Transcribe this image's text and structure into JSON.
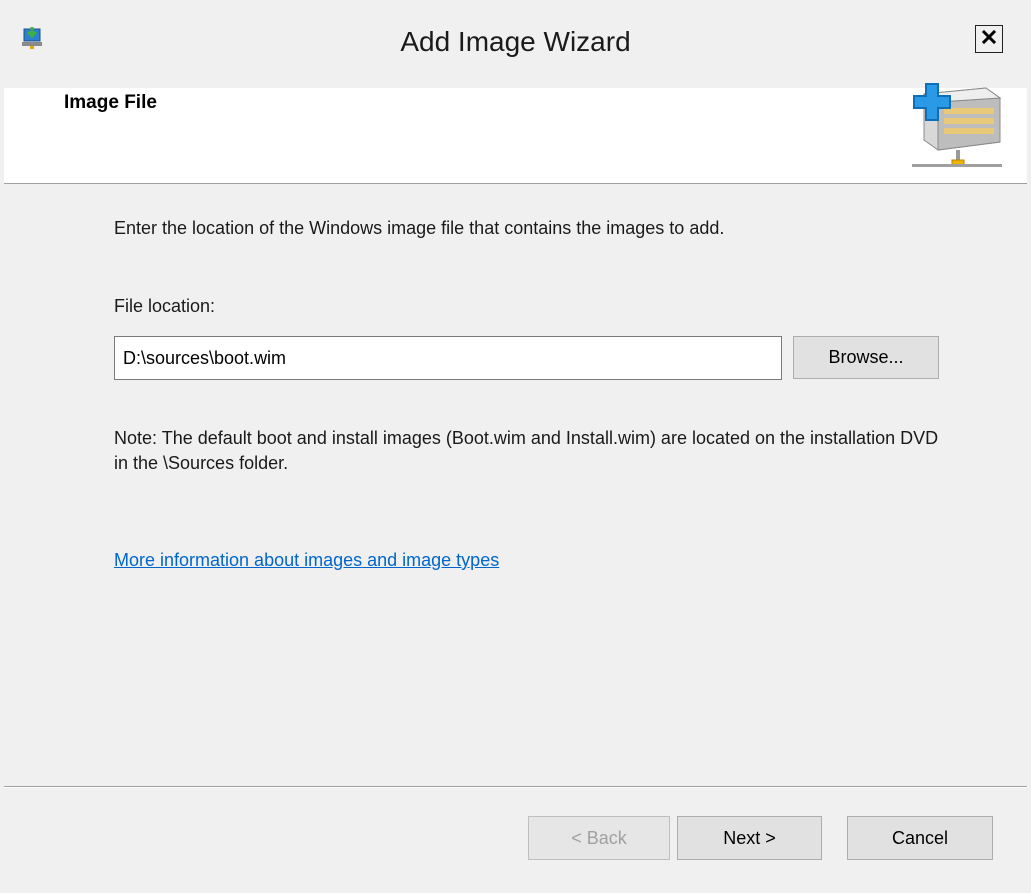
{
  "window": {
    "title": "Add Image Wizard",
    "close_glyph": "✕"
  },
  "header": {
    "title": "Image File"
  },
  "content": {
    "intro": "Enter the location of the Windows image file that contains the images to add.",
    "file_label": "File location:",
    "file_value": "D:\\sources\\boot.wim",
    "browse_label": "Browse...",
    "note": "Note: The default boot and install images (Boot.wim and Install.wim) are located on the installation DVD in the \\Sources folder.",
    "more_link": "More information about images and image types"
  },
  "footer": {
    "back_label": "< Back",
    "next_label": "Next >",
    "cancel_label": "Cancel"
  },
  "icons": {
    "app": "wds-server-icon",
    "close": "close-icon",
    "header": "add-image-icon"
  },
  "colors": {
    "link": "#0066cc",
    "window_bg": "#f0f0f0",
    "header_bg": "#ffffff",
    "accent_blue": "#1e90e0"
  }
}
